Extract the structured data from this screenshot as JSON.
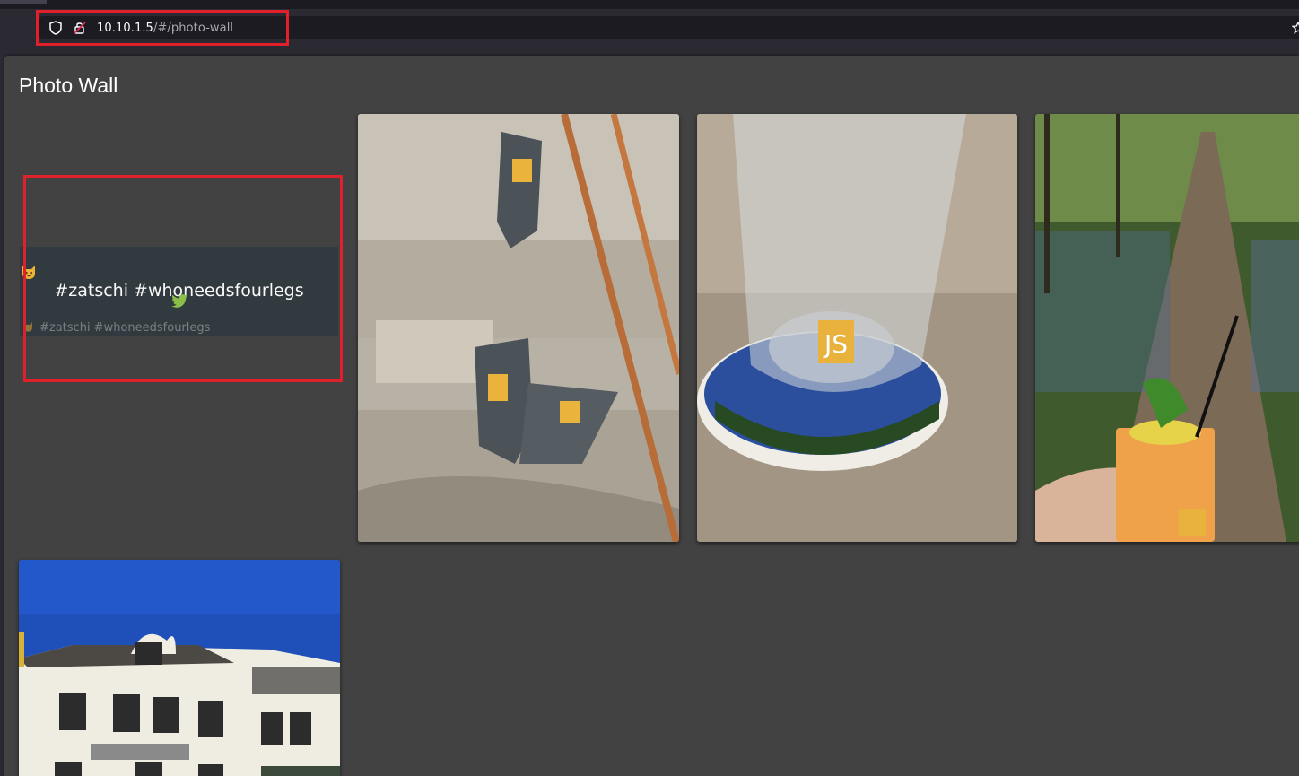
{
  "browser": {
    "url_host": "10.10.1.5",
    "url_path": "/#/photo-wall"
  },
  "page": {
    "title": "Photo Wall"
  },
  "photos": [
    {
      "caption": "#zatschi #whoneedsfourlegs",
      "icon": "cat-emoji",
      "source_icon": "twitter-icon",
      "source_color": "#8bc34a",
      "state": "hovered"
    },
    {
      "subject": "stickers-on-wall-bracket"
    },
    {
      "subject": "glass-on-coaster"
    },
    {
      "subject": "drink-in-forest-path"
    },
    {
      "subject": "white-building-blue-sky"
    }
  ],
  "colors": {
    "annotation": "#e0202a",
    "background": "#424242",
    "card": "#303a3f"
  }
}
